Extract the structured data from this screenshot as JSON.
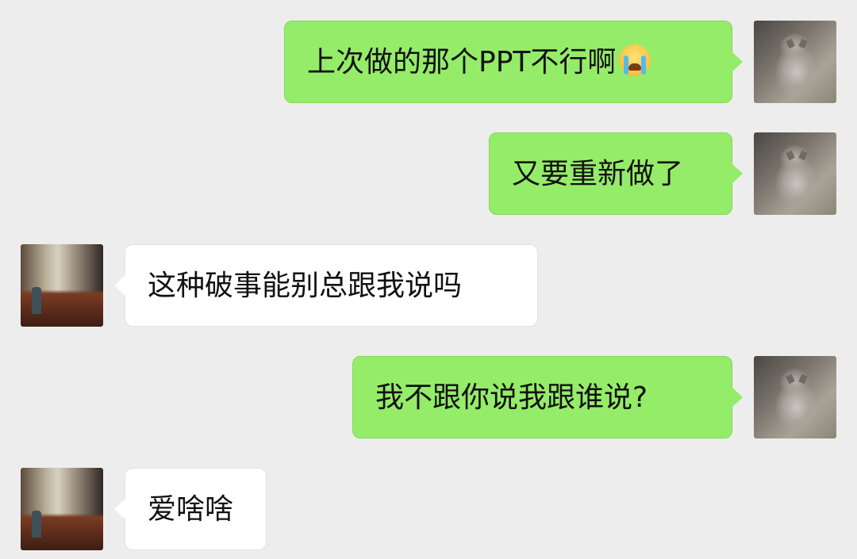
{
  "messages": [
    {
      "from": "me",
      "text": "上次做的那个PPT不行啊",
      "emoji": "crying-emoji"
    },
    {
      "from": "me",
      "text": "又要重新做了"
    },
    {
      "from": "other",
      "text": "这种破事能别总跟我说吗"
    },
    {
      "from": "me",
      "text": "我不跟你说我跟谁说?"
    },
    {
      "from": "other",
      "text": "爱啥啥"
    }
  ],
  "colors": {
    "background": "#ededed",
    "sent_bubble": "#95ec69",
    "received_bubble": "#ffffff"
  }
}
